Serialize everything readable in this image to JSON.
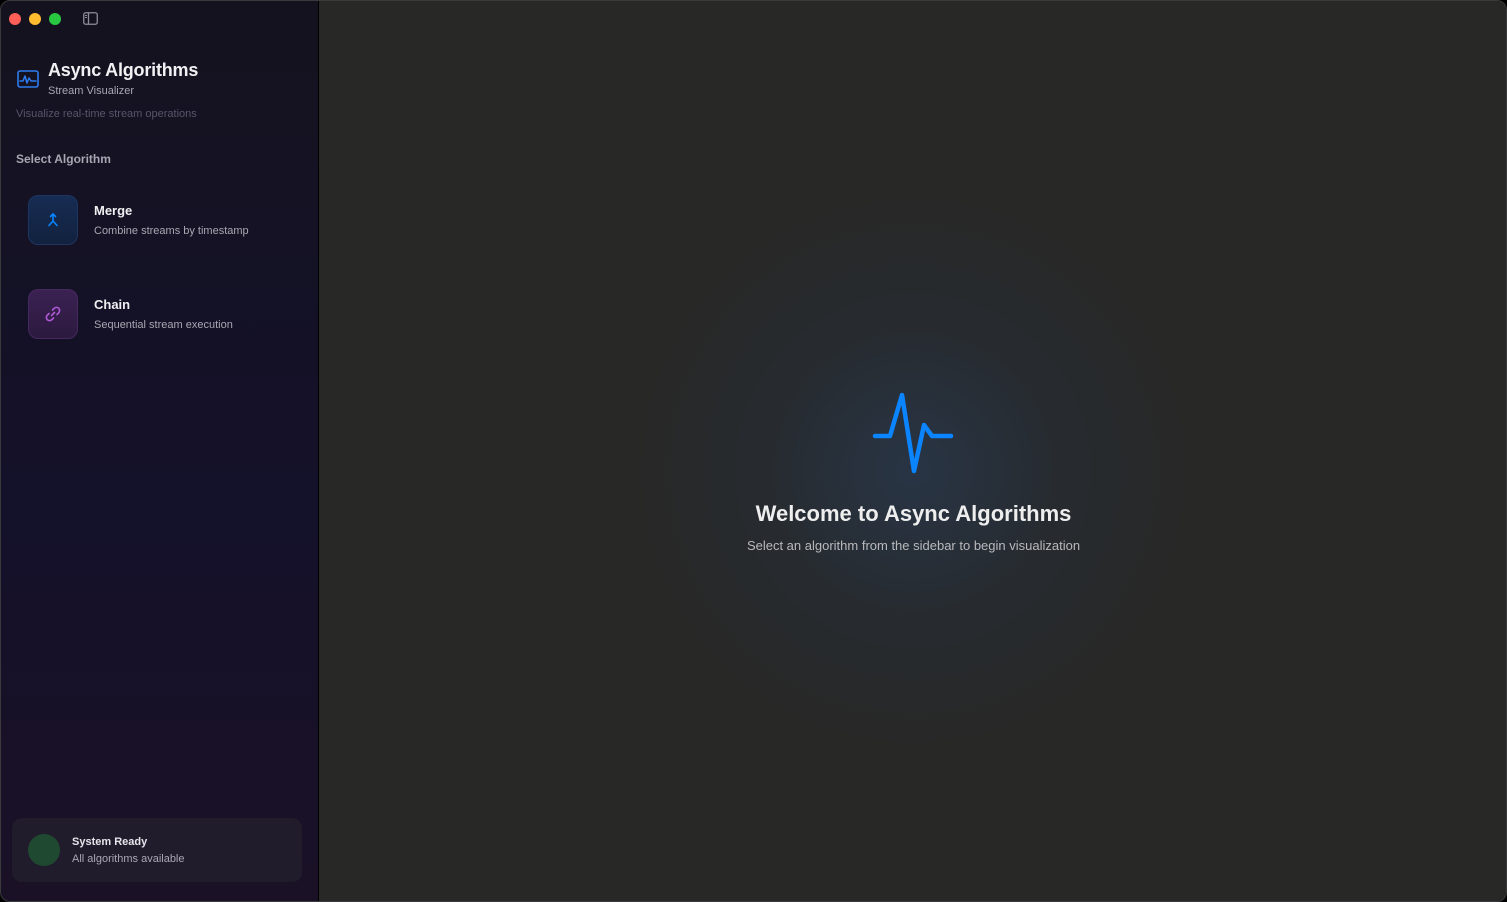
{
  "app": {
    "title": "Async Algorithms",
    "subtitle": "Stream Visualizer",
    "tagline": "Visualize real-time stream operations"
  },
  "sidebar": {
    "section_label": "Select Algorithm",
    "algorithms": [
      {
        "name": "Merge",
        "description": "Combine streams by timestamp",
        "icon": "merge-arrow-icon",
        "accent": "#0a84ff"
      },
      {
        "name": "Chain",
        "description": "Sequential stream execution",
        "icon": "link-icon",
        "accent": "#b05ad9"
      }
    ],
    "status": {
      "title": "System Ready",
      "subtitle": "All algorithms available",
      "color": "#1f4a31"
    }
  },
  "main": {
    "title": "Welcome to Async Algorithms",
    "subtitle": "Select an algorithm from the sidebar to begin visualization",
    "icon": "waveform-pulse-icon",
    "accent": "#0a84ff"
  }
}
